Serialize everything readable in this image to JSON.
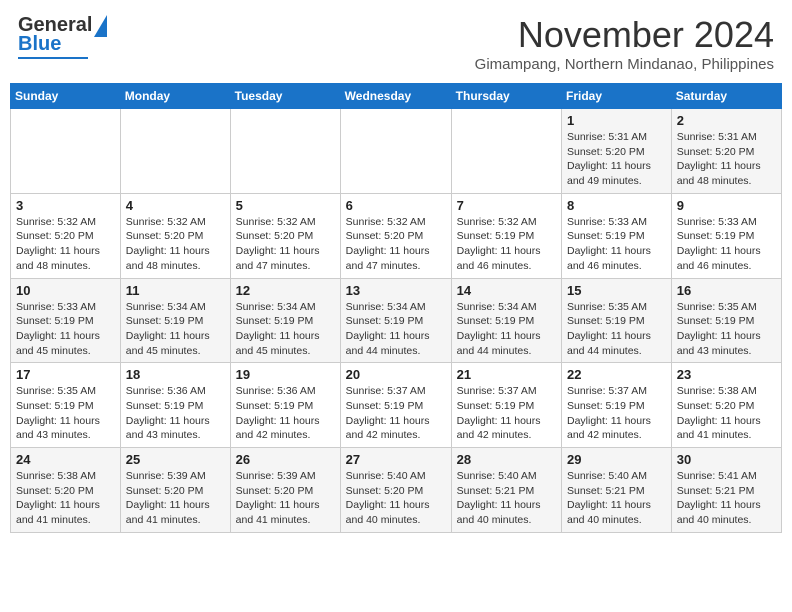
{
  "header": {
    "logo_line1": "General",
    "logo_line2": "Blue",
    "month": "November 2024",
    "location": "Gimampang, Northern Mindanao, Philippines"
  },
  "weekdays": [
    "Sunday",
    "Monday",
    "Tuesday",
    "Wednesday",
    "Thursday",
    "Friday",
    "Saturday"
  ],
  "weeks": [
    [
      {
        "day": "",
        "info": ""
      },
      {
        "day": "",
        "info": ""
      },
      {
        "day": "",
        "info": ""
      },
      {
        "day": "",
        "info": ""
      },
      {
        "day": "",
        "info": ""
      },
      {
        "day": "1",
        "info": "Sunrise: 5:31 AM\nSunset: 5:20 PM\nDaylight: 11 hours\nand 49 minutes."
      },
      {
        "day": "2",
        "info": "Sunrise: 5:31 AM\nSunset: 5:20 PM\nDaylight: 11 hours\nand 48 minutes."
      }
    ],
    [
      {
        "day": "3",
        "info": "Sunrise: 5:32 AM\nSunset: 5:20 PM\nDaylight: 11 hours\nand 48 minutes."
      },
      {
        "day": "4",
        "info": "Sunrise: 5:32 AM\nSunset: 5:20 PM\nDaylight: 11 hours\nand 48 minutes."
      },
      {
        "day": "5",
        "info": "Sunrise: 5:32 AM\nSunset: 5:20 PM\nDaylight: 11 hours\nand 47 minutes."
      },
      {
        "day": "6",
        "info": "Sunrise: 5:32 AM\nSunset: 5:20 PM\nDaylight: 11 hours\nand 47 minutes."
      },
      {
        "day": "7",
        "info": "Sunrise: 5:32 AM\nSunset: 5:19 PM\nDaylight: 11 hours\nand 46 minutes."
      },
      {
        "day": "8",
        "info": "Sunrise: 5:33 AM\nSunset: 5:19 PM\nDaylight: 11 hours\nand 46 minutes."
      },
      {
        "day": "9",
        "info": "Sunrise: 5:33 AM\nSunset: 5:19 PM\nDaylight: 11 hours\nand 46 minutes."
      }
    ],
    [
      {
        "day": "10",
        "info": "Sunrise: 5:33 AM\nSunset: 5:19 PM\nDaylight: 11 hours\nand 45 minutes."
      },
      {
        "day": "11",
        "info": "Sunrise: 5:34 AM\nSunset: 5:19 PM\nDaylight: 11 hours\nand 45 minutes."
      },
      {
        "day": "12",
        "info": "Sunrise: 5:34 AM\nSunset: 5:19 PM\nDaylight: 11 hours\nand 45 minutes."
      },
      {
        "day": "13",
        "info": "Sunrise: 5:34 AM\nSunset: 5:19 PM\nDaylight: 11 hours\nand 44 minutes."
      },
      {
        "day": "14",
        "info": "Sunrise: 5:34 AM\nSunset: 5:19 PM\nDaylight: 11 hours\nand 44 minutes."
      },
      {
        "day": "15",
        "info": "Sunrise: 5:35 AM\nSunset: 5:19 PM\nDaylight: 11 hours\nand 44 minutes."
      },
      {
        "day": "16",
        "info": "Sunrise: 5:35 AM\nSunset: 5:19 PM\nDaylight: 11 hours\nand 43 minutes."
      }
    ],
    [
      {
        "day": "17",
        "info": "Sunrise: 5:35 AM\nSunset: 5:19 PM\nDaylight: 11 hours\nand 43 minutes."
      },
      {
        "day": "18",
        "info": "Sunrise: 5:36 AM\nSunset: 5:19 PM\nDaylight: 11 hours\nand 43 minutes."
      },
      {
        "day": "19",
        "info": "Sunrise: 5:36 AM\nSunset: 5:19 PM\nDaylight: 11 hours\nand 42 minutes."
      },
      {
        "day": "20",
        "info": "Sunrise: 5:37 AM\nSunset: 5:19 PM\nDaylight: 11 hours\nand 42 minutes."
      },
      {
        "day": "21",
        "info": "Sunrise: 5:37 AM\nSunset: 5:19 PM\nDaylight: 11 hours\nand 42 minutes."
      },
      {
        "day": "22",
        "info": "Sunrise: 5:37 AM\nSunset: 5:19 PM\nDaylight: 11 hours\nand 42 minutes."
      },
      {
        "day": "23",
        "info": "Sunrise: 5:38 AM\nSunset: 5:20 PM\nDaylight: 11 hours\nand 41 minutes."
      }
    ],
    [
      {
        "day": "24",
        "info": "Sunrise: 5:38 AM\nSunset: 5:20 PM\nDaylight: 11 hours\nand 41 minutes."
      },
      {
        "day": "25",
        "info": "Sunrise: 5:39 AM\nSunset: 5:20 PM\nDaylight: 11 hours\nand 41 minutes."
      },
      {
        "day": "26",
        "info": "Sunrise: 5:39 AM\nSunset: 5:20 PM\nDaylight: 11 hours\nand 41 minutes."
      },
      {
        "day": "27",
        "info": "Sunrise: 5:40 AM\nSunset: 5:20 PM\nDaylight: 11 hours\nand 40 minutes."
      },
      {
        "day": "28",
        "info": "Sunrise: 5:40 AM\nSunset: 5:21 PM\nDaylight: 11 hours\nand 40 minutes."
      },
      {
        "day": "29",
        "info": "Sunrise: 5:40 AM\nSunset: 5:21 PM\nDaylight: 11 hours\nand 40 minutes."
      },
      {
        "day": "30",
        "info": "Sunrise: 5:41 AM\nSunset: 5:21 PM\nDaylight: 11 hours\nand 40 minutes."
      }
    ]
  ]
}
